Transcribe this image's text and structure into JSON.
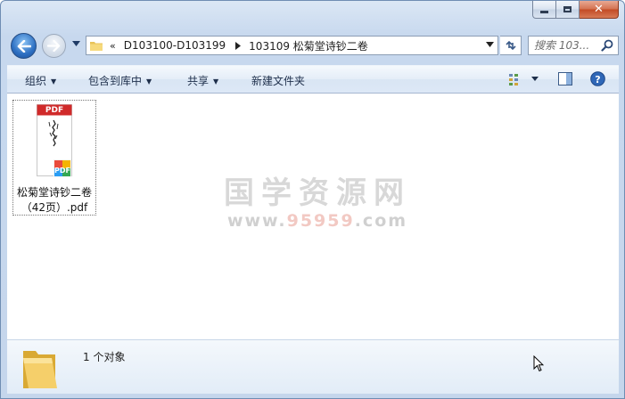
{
  "window": {
    "close_glyph": "✕"
  },
  "nav": {
    "back_icon": "back-arrow-icon",
    "forward_icon": "forward-arrow-icon",
    "breadcrumb_overflow": "«",
    "breadcrumbs": [
      "D103100-D103199",
      "103109 松菊堂诗钞二卷"
    ],
    "search_placeholder": "搜索 103..."
  },
  "toolbar": {
    "organize": "组织",
    "include_in_library": "包含到库中",
    "share": "共享",
    "new_folder": "新建文件夹"
  },
  "files": [
    {
      "name_line1": "松菊堂诗钞二卷",
      "name_line2": "（42页）.pdf",
      "badge": "PDF",
      "type": "pdf"
    }
  ],
  "watermark": {
    "title": "国学资源网",
    "url_prefix": "www.",
    "url_highlight": "95959",
    "url_suffix": ".com"
  },
  "details": {
    "count_text": "1 个对象"
  },
  "colors": {
    "pdf_red": "#d02a2a",
    "frame_blue": "#c7d8ee",
    "toolbar_text": "#1e2f4b"
  }
}
